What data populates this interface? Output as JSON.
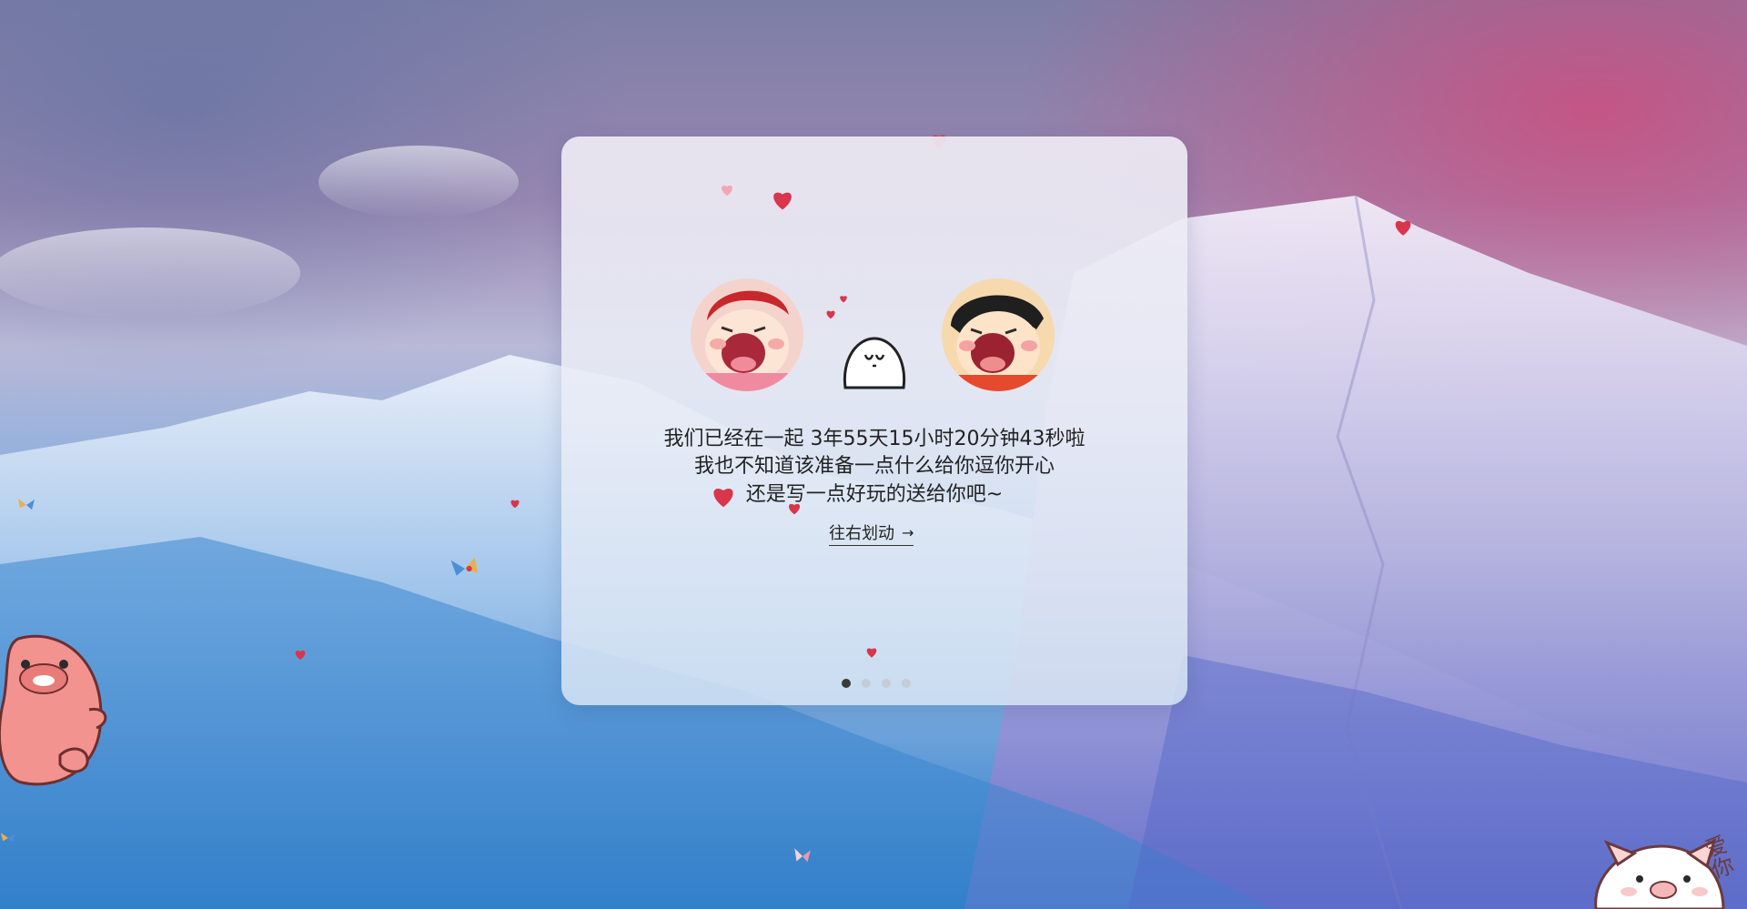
{
  "message": {
    "line1": "我们已经在一起  3年55天15小时20分钟43秒啦",
    "line2": "我也不知道该准备一点什么给你逗你开心",
    "line3": "还是写一点好玩的送给你吧~"
  },
  "swipe": {
    "label": "往右划动",
    "arrow": "→"
  },
  "pager": {
    "count": 4,
    "active_index": 1
  },
  "sticker_text": "爱你",
  "colors": {
    "heart": "#d8364a",
    "accent": "#d84c86",
    "card_text": "#222222"
  },
  "icons": [
    "heart-icon",
    "arrow-right-icon",
    "butterfly-icon",
    "pig-sticker",
    "pink-creature-sticker"
  ]
}
